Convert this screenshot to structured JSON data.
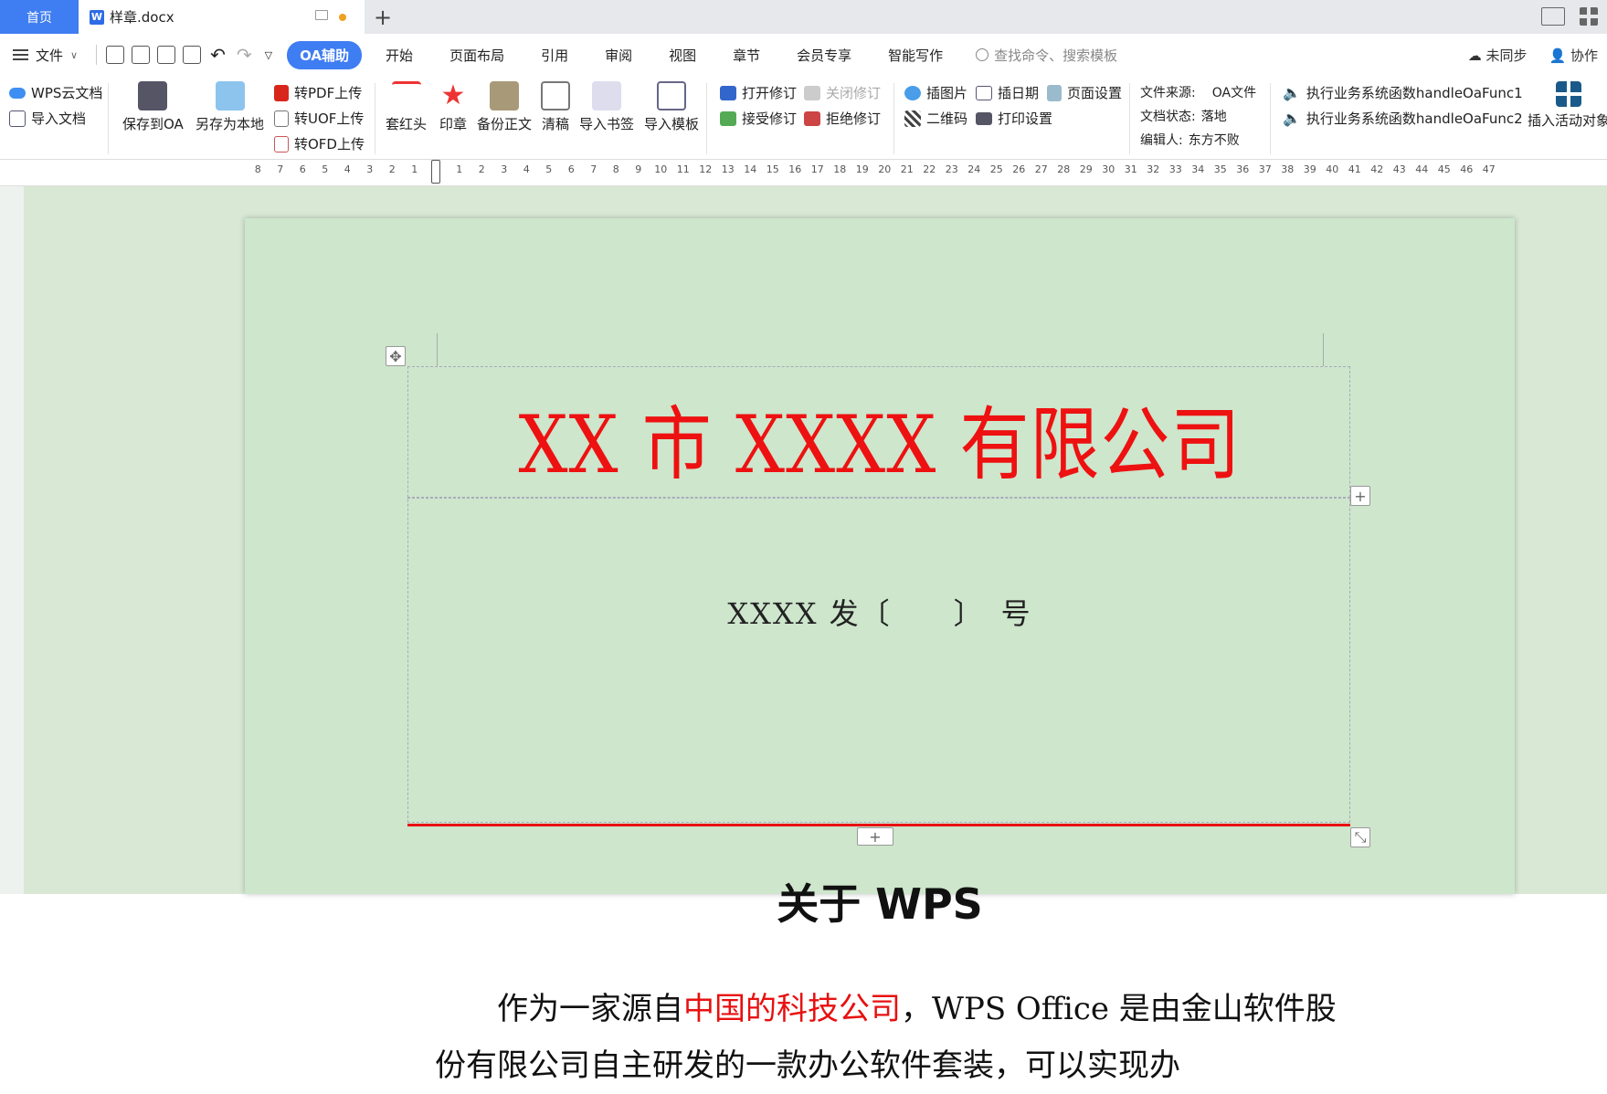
{
  "tabs": {
    "home": "首页",
    "doc": "样章.docx",
    "add": "+"
  },
  "menu": {
    "file": "文件",
    "items": [
      "OA辅助",
      "开始",
      "页面布局",
      "引用",
      "审阅",
      "视图",
      "章节",
      "会员专享",
      "智能写作"
    ],
    "search_placeholder": "查找命令、搜索模板",
    "sync": "未同步",
    "collab": "协作"
  },
  "ribbon": {
    "cloud_doc": "WPS云文档",
    "import_doc": "导入文档",
    "save_oa": "保存到OA",
    "save_local": "另存为本地",
    "to_pdf": "转PDF上传",
    "to_uof": "转UOF上传",
    "to_ofd": "转OFD上传",
    "red_head": "套红头",
    "seal": "印章",
    "backup": "备份正文",
    "clean": "清稿",
    "import_bookmark": "导入书签",
    "import_template": "导入模板",
    "open_rev": "打开修订",
    "close_rev": "关闭修订",
    "accept_rev": "接受修订",
    "reject_rev": "拒绝修订",
    "insert_pic": "插图片",
    "insert_date": "插日期",
    "page_setup": "页面设置",
    "qrcode": "二维码",
    "print_setup": "打印设置",
    "source_label": "文件来源:",
    "source_value": "OA文件",
    "status_label": "文档状态:",
    "status_value": "落地",
    "editor_label": "编辑人:",
    "editor_value": "东方不败",
    "func1": "执行业务系统函数handleOaFunc1",
    "func2": "执行业务系统函数handleOaFunc2",
    "insert_active": "插入活动对象"
  },
  "ruler": [
    "8",
    "7",
    "6",
    "5",
    "4",
    "3",
    "2",
    "1",
    "",
    "1",
    "2",
    "3",
    "4",
    "5",
    "6",
    "7",
    "8",
    "9",
    "10",
    "11",
    "12",
    "13",
    "14",
    "15",
    "16",
    "17",
    "18",
    "19",
    "20",
    "21",
    "22",
    "23",
    "24",
    "25",
    "26",
    "27",
    "28",
    "29",
    "30",
    "31",
    "32",
    "33",
    "34",
    "35",
    "36",
    "37",
    "38",
    "39",
    "40",
    "41",
    "42",
    "43",
    "44",
    "45",
    "46",
    "47"
  ],
  "document": {
    "company": "XX 市 XXXX 有限公司",
    "doc_number": "XXXX 发〔　　〕　号",
    "heading": "关于 WPS",
    "para_pre": "作为一家源自",
    "para_red": "中国的科技公司",
    "para_post": "，WPS Office 是由金山软件股份有限公司自主研发的一款办公软件套装，可以实现办"
  },
  "colors": {
    "accent": "#3f7df2",
    "red": "#e81010",
    "page_bg": "#cde6cc"
  }
}
